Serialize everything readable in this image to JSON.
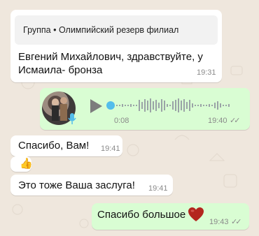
{
  "messages": {
    "m1": {
      "quote": "Группа • Олимпийский резерв филиал",
      "line1": "Евгений Михайлович, здравствуйте,  у",
      "line2": "Исмаила- бронза",
      "time": "19:31"
    },
    "voice": {
      "duration": "0:08",
      "time": "19:40"
    },
    "m2": {
      "text": "Спасибо,  Вам!",
      "time": "19:41"
    },
    "m3": {
      "emoji": "👍"
    },
    "m4": {
      "text": "Это  тоже Ваша заслуга!",
      "time": "19:41"
    },
    "m5": {
      "text": "Спасибо большое",
      "time": "19:43"
    }
  },
  "colors": {
    "background": "#efe7dd",
    "incoming_bubble": "#ffffff",
    "outgoing_bubble": "#d9fdd3",
    "heart": "#b3261e"
  }
}
